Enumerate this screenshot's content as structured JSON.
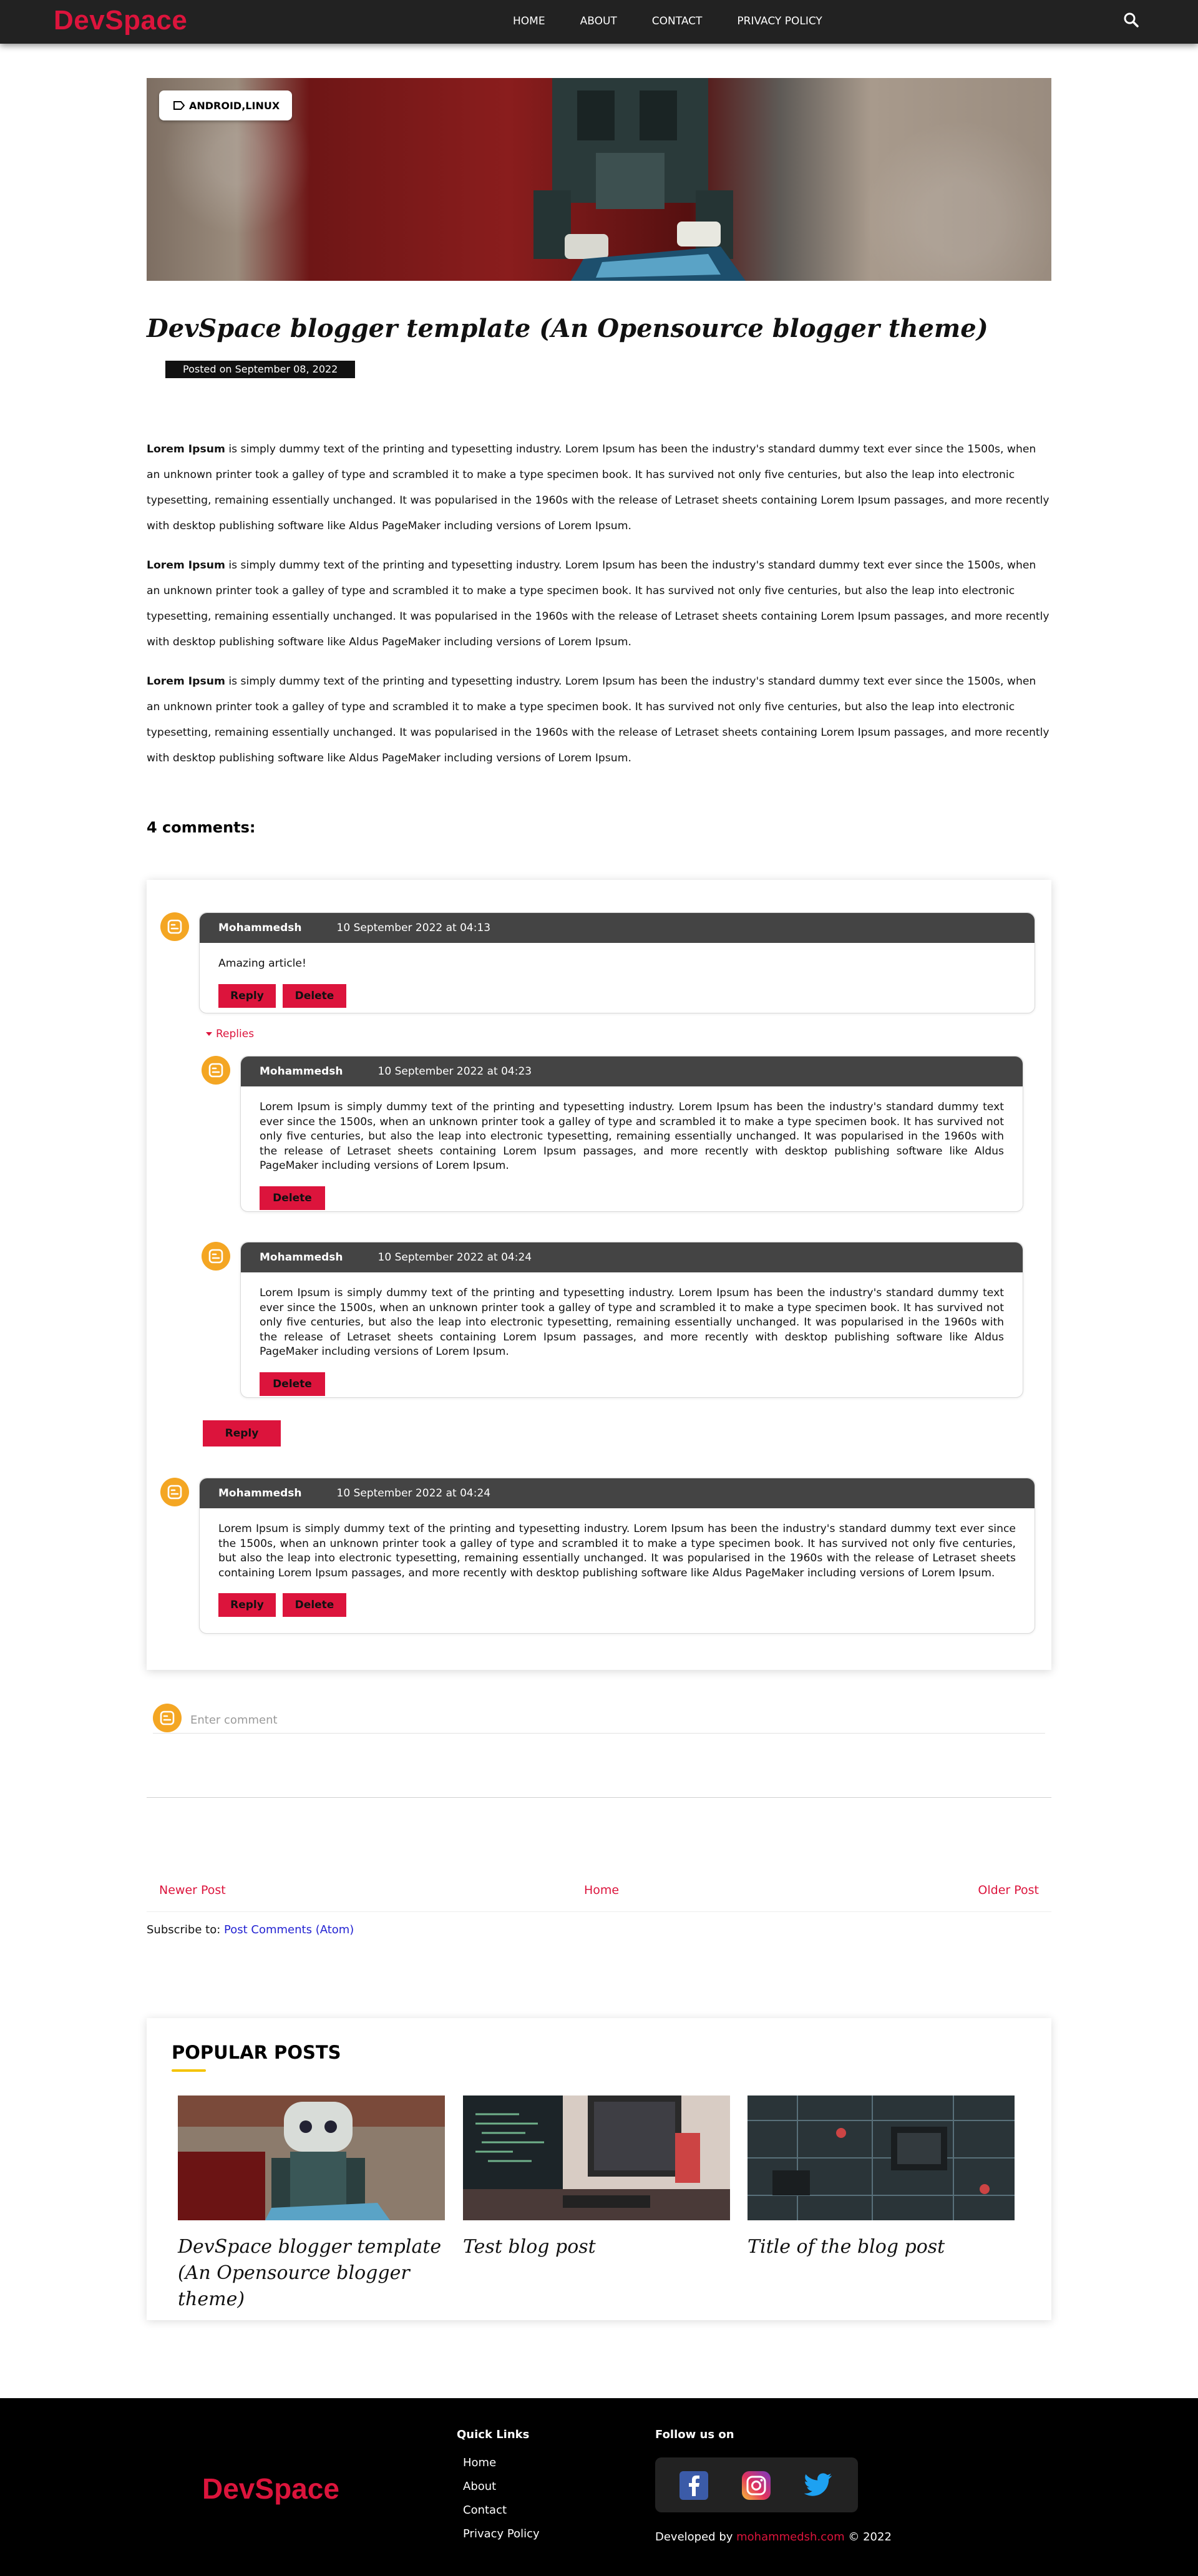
{
  "nav": {
    "brand": "DevSpace",
    "links": [
      "HOME",
      "ABOUT",
      "CONTACT",
      "PRIVACY POLICY"
    ],
    "icon": "search-icon"
  },
  "post": {
    "category": "ANDROID,LINUX",
    "title": "DevSpace blogger template (An Opensource blogger theme)",
    "date": "Posted on September 08, 2022",
    "paragraphs": [
      {
        "lead": "Lorem Ipsum",
        "text": " is simply dummy text of the printing and typesetting industry. Lorem Ipsum has been the industry's standard dummy text ever since the 1500s, when an unknown printer took a galley of type and scrambled it to make a type specimen book. It has survived not only five centuries, but also the leap into electronic typesetting, remaining essentially unchanged. It was popularised in the 1960s with the release of Letraset sheets containing Lorem Ipsum passages, and more recently with desktop publishing software like Aldus PageMaker including versions of Lorem Ipsum."
      },
      {
        "lead": "Lorem Ipsum",
        "text": " is simply dummy text of the printing and typesetting industry. Lorem Ipsum has been the industry's standard dummy text ever since the 1500s, when an unknown printer took a galley of type and scrambled it to make a type specimen book. It has survived not only five centuries, but also the leap into electronic typesetting, remaining essentially unchanged. It was popularised in the 1960s with the release of Letraset sheets containing Lorem Ipsum passages, and more recently with desktop publishing software like Aldus PageMaker including versions of Lorem Ipsum."
      },
      {
        "lead": "Lorem Ipsum",
        "text": " is simply dummy text of the printing and typesetting industry. Lorem Ipsum has been the industry's standard dummy text ever since the 1500s, when an unknown printer took a galley of type and scrambled it to make a type specimen book. It has survived not only five centuries, but also the leap into electronic typesetting, remaining essentially unchanged. It was popularised in the 1960s with the release of Letraset sheets containing Lorem Ipsum passages, and more recently with desktop publishing software like Aldus PageMaker including versions of Lorem Ipsum."
      }
    ]
  },
  "comments": {
    "heading": "4 comments:",
    "replies_label": "Replies",
    "reply_label": "Reply",
    "delete_label": "Delete",
    "items": [
      {
        "author": "Mohammedsh",
        "time": "10 September 2022 at 04:13",
        "text": "Amazing article!"
      },
      {
        "author": "Mohammedsh",
        "time": "10 September 2022 at 04:23",
        "text": "Lorem Ipsum is simply dummy text of the printing and typesetting industry. Lorem Ipsum has been the industry's standard dummy text ever since the 1500s, when an unknown printer took a galley of type and scrambled it to make a type specimen book. It has survived not only five centuries, but also the leap into electronic typesetting, remaining essentially unchanged. It was popularised in the 1960s with the release of Letraset sheets containing Lorem Ipsum passages, and more recently with desktop publishing software like Aldus PageMaker including versions of Lorem Ipsum."
      },
      {
        "author": "Mohammedsh",
        "time": "10 September 2022 at 04:24",
        "text": "Lorem Ipsum is simply dummy text of the printing and typesetting industry. Lorem Ipsum has been the industry's standard dummy text ever since the 1500s, when an unknown printer took a galley of type and scrambled it to make a type specimen book. It has survived not only five centuries, but also the leap into electronic typesetting, remaining essentially unchanged. It was popularised in the 1960s with the release of Letraset sheets containing Lorem Ipsum passages, and more recently with desktop publishing software like Aldus PageMaker including versions of Lorem Ipsum."
      },
      {
        "author": "Mohammedsh",
        "time": "10 September 2022 at 04:24",
        "text": "Lorem Ipsum is simply dummy text of the printing and typesetting industry. Lorem Ipsum has been the industry's standard dummy text ever since the 1500s, when an unknown printer took a galley of type and scrambled it to make a type specimen book. It has survived not only five centuries, but also the leap into electronic typesetting, remaining essentially unchanged. It was popularised in the 1960s with the release of Letraset sheets containing Lorem Ipsum passages, and more recently with desktop publishing software like Aldus PageMaker including versions of Lorem Ipsum."
      }
    ],
    "input_placeholder": "Enter comment"
  },
  "pager": {
    "newer": "Newer Post",
    "home": "Home",
    "older": "Older Post",
    "subscribe_prefix": "Subscribe to: ",
    "subscribe_link": "Post Comments (Atom)"
  },
  "popular": {
    "heading": "POPULAR POSTS",
    "posts": [
      {
        "title": "DevSpace blogger template (An Opensource blogger theme)"
      },
      {
        "title": "Test blog post"
      },
      {
        "title": "Title of the blog post"
      }
    ]
  },
  "footer": {
    "brand": "DevSpace",
    "quick_links_title": "Quick Links",
    "quick_links": [
      "Home",
      "About",
      "Contact",
      "Privacy Policy"
    ],
    "follow_title": "Follow us on",
    "social_icons": [
      "facebook-icon",
      "instagram-icon",
      "twitter-icon"
    ],
    "credit_prefix": "Developed by ",
    "credit_link": "mohammedsh.com",
    "credit_suffix": " © 2022"
  },
  "colors": {
    "accent": "#dc143c",
    "navbar": "#222222",
    "comment_header": "#444444",
    "avatar": "#f4a623",
    "footer": "#000000"
  }
}
